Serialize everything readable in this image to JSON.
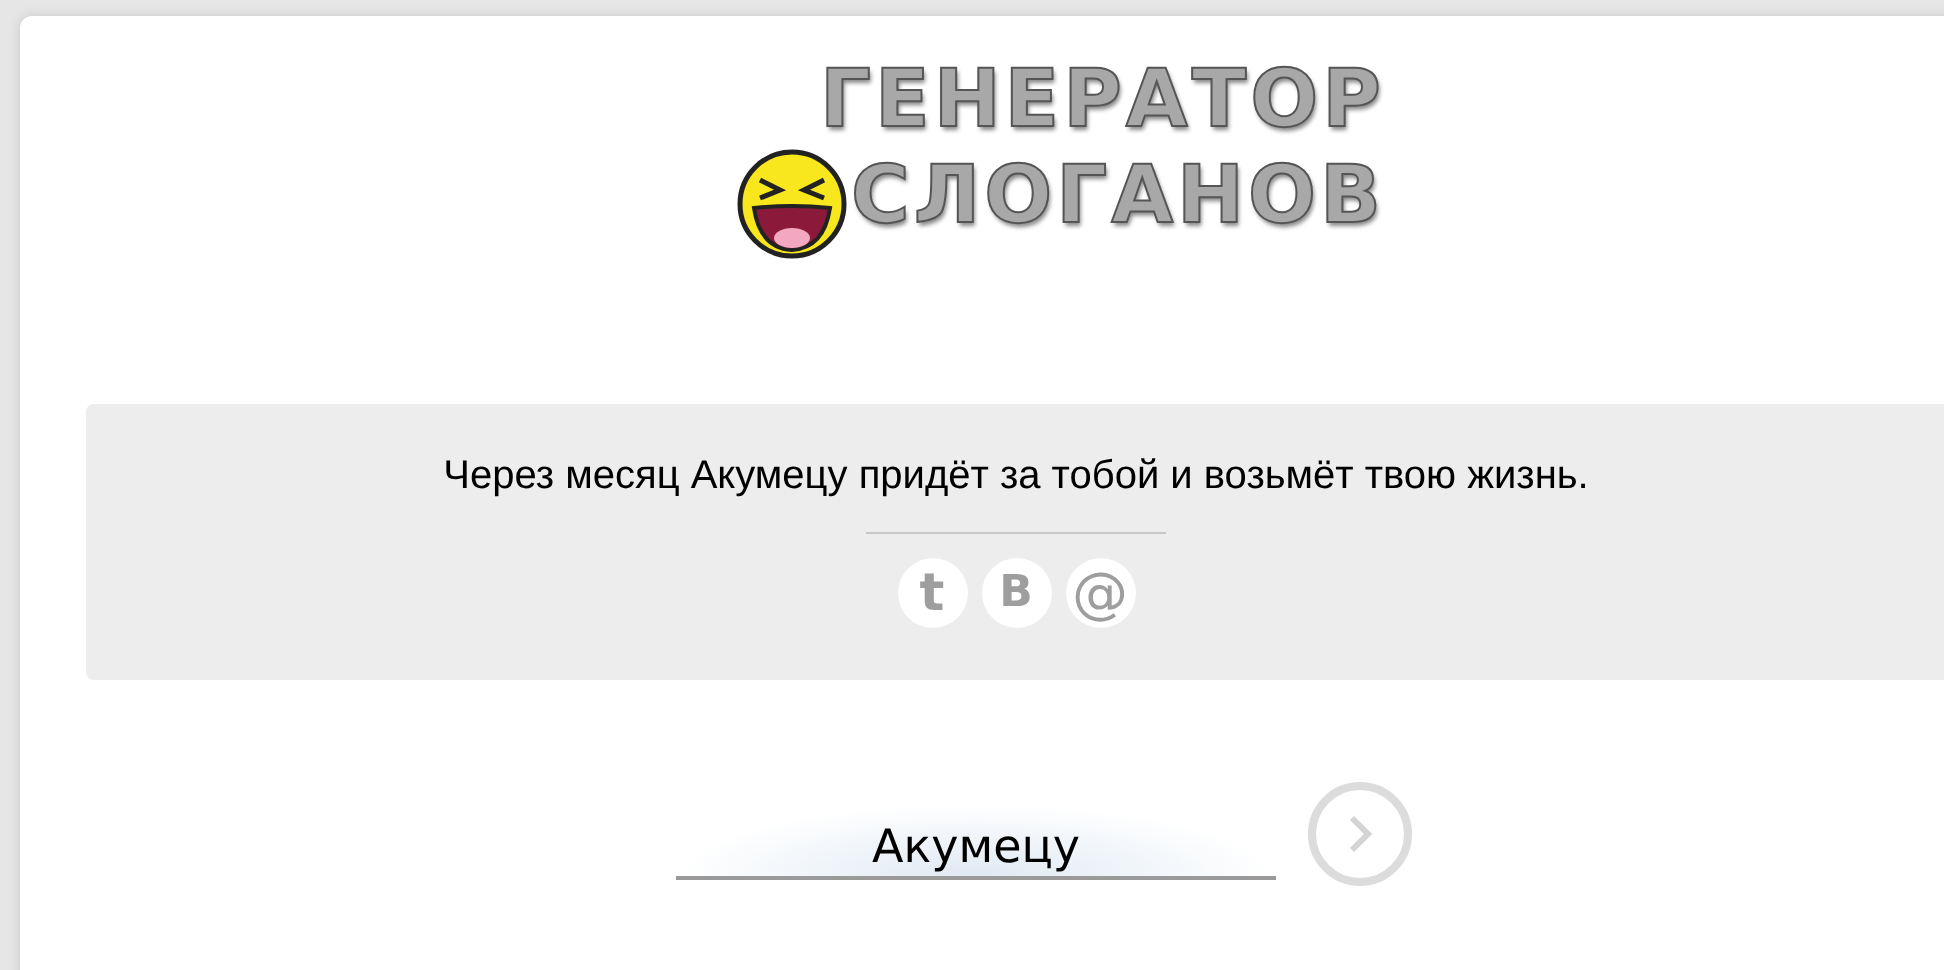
{
  "logo": {
    "line_1": "ГЕНЕРАТОР",
    "line_2": "СЛОГАНОВ"
  },
  "slogan": {
    "text": "Через месяц Акумецу придёт за тобой и возьмёт твою жизнь.",
    "share_buttons": [
      {
        "kind": "twitter",
        "glyph": "t"
      },
      {
        "kind": "vk",
        "glyph": "В"
      },
      {
        "kind": "mail",
        "glyph": "@"
      }
    ]
  },
  "name_field": {
    "value": "Акумецу"
  }
}
